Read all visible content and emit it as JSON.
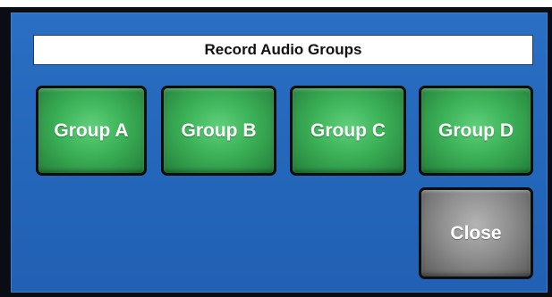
{
  "dialog": {
    "title": "Record Audio Groups"
  },
  "groups": [
    {
      "label": "Group A"
    },
    {
      "label": "Group B"
    },
    {
      "label": "Group C"
    },
    {
      "label": "Group D"
    }
  ],
  "actions": {
    "close_label": "Close"
  },
  "colors": {
    "dialog_background": "#2467bb",
    "group_button": "#3cb157",
    "close_button": "#8f8f8f",
    "title_background": "#ffffff"
  }
}
